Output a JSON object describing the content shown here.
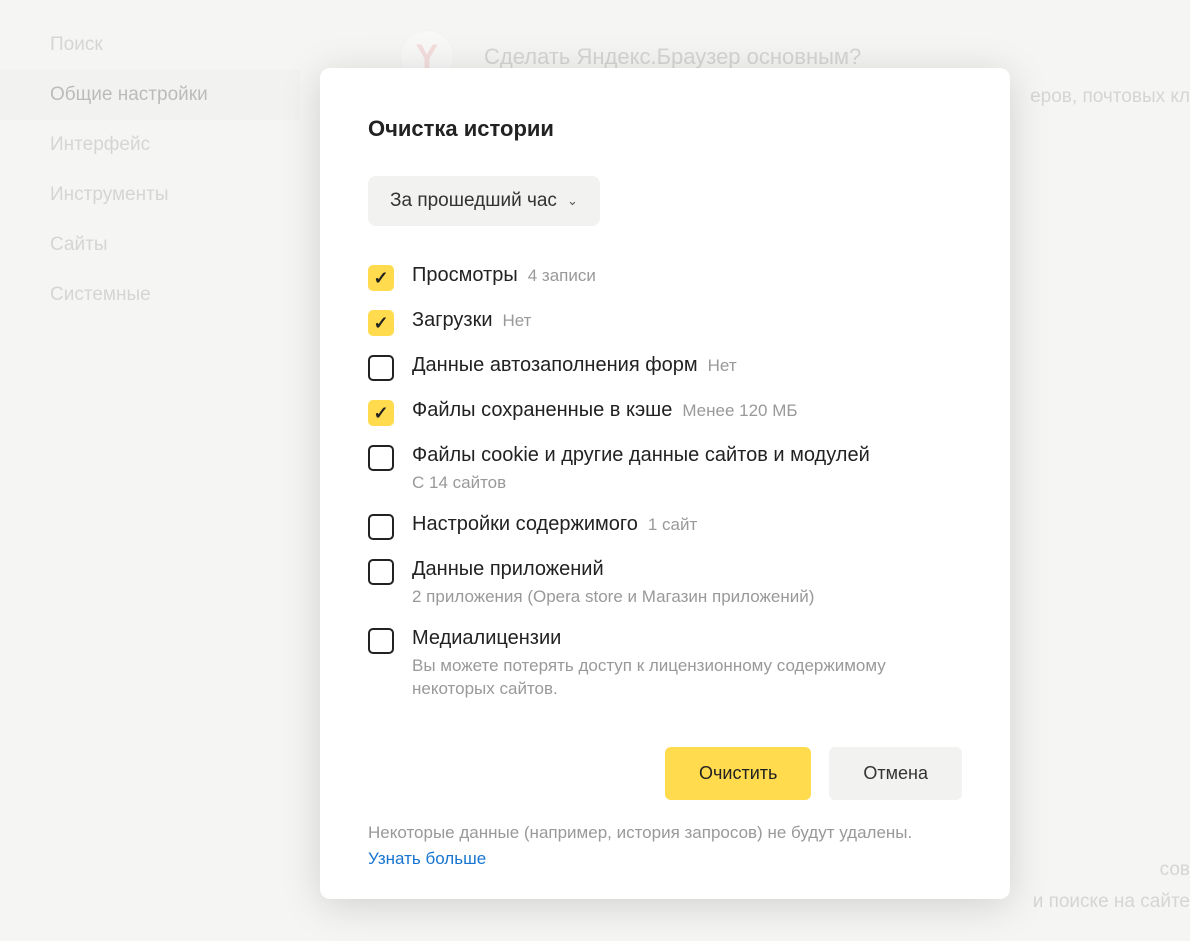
{
  "sidebar": {
    "items": [
      {
        "label": "Поиск"
      },
      {
        "label": "Общие настройки"
      },
      {
        "label": "Интерфейс"
      },
      {
        "label": "Инструменты"
      },
      {
        "label": "Сайты"
      },
      {
        "label": "Системные"
      }
    ],
    "activeIndex": 1
  },
  "main": {
    "logo_glyph": "Y",
    "prompt": "Сделать Яндекс.Браузер основным?",
    "peek1": "еров, почтовых кл",
    "peek2": "сов",
    "peek3": "и поиске на сайте"
  },
  "dialog": {
    "title": "Очистка истории",
    "time_range": "За прошедший час",
    "options": [
      {
        "checked": true,
        "label": "Просмотры",
        "sub_inline": "4 записи"
      },
      {
        "checked": true,
        "label": "Загрузки",
        "sub_inline": "Нет"
      },
      {
        "checked": false,
        "label": "Данные автозаполнения форм",
        "sub_inline": "Нет"
      },
      {
        "checked": true,
        "label": "Файлы сохраненные в кэше",
        "sub_inline": "Менее 120 МБ"
      },
      {
        "checked": false,
        "label": "Файлы cookie и другие данные сайтов и модулей",
        "sub_below": "С 14 сайтов"
      },
      {
        "checked": false,
        "label": "Настройки содержимого",
        "sub_inline": "1 сайт"
      },
      {
        "checked": false,
        "label": "Данные приложений",
        "sub_below": "2 приложения (Opera store и Магазин приложений)"
      },
      {
        "checked": false,
        "label": "Медиалицензии",
        "sub_below": "Вы можете потерять доступ к лицензионному содержимому некоторых сайтов."
      }
    ],
    "clear_button": "Очистить",
    "cancel_button": "Отмена",
    "footer_note": "Некоторые данные (например, история запросов) не будут удалены.",
    "footer_link": "Узнать больше"
  }
}
